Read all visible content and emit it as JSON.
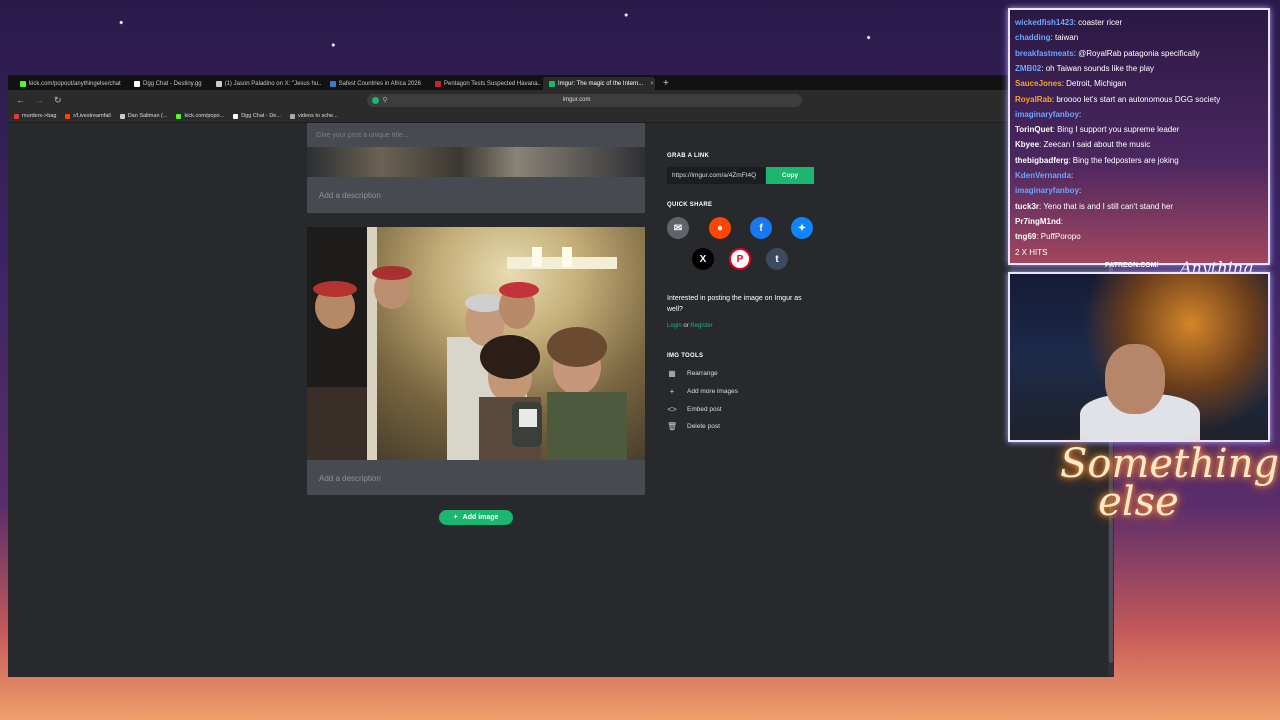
{
  "browser": {
    "tabs": [
      {
        "label": "kick.com/popout/anythingelse/chat",
        "color": "#53fc18",
        "active": false
      },
      {
        "label": "Dgg Chat - Destiny.gg",
        "color": "#ffffff",
        "active": false
      },
      {
        "label": "(1) Jason Paladino on X: \"Jesus hu...",
        "color": "#cccccc",
        "active": false
      },
      {
        "label": "Safest Countries in Africa 2026",
        "color": "#3d7bd8",
        "active": false
      },
      {
        "label": "Pentagon Tests Suspected Havana...",
        "color": "#c4262e",
        "active": false
      },
      {
        "label": "Imgur: The magic of the Intern...",
        "color": "#1bb76e",
        "active": true
      }
    ],
    "new_tab": "+",
    "address": "imgur.com",
    "bookmarks": [
      {
        "label": "murders->bag",
        "color": "#e33"
      },
      {
        "label": "r/Livestreamfail",
        "color": "#ff4500"
      },
      {
        "label": "Dan Saltman (...",
        "color": "#ccc"
      },
      {
        "label": "kick.com/popo...",
        "color": "#53fc18"
      },
      {
        "label": "Dgg Chat - De...",
        "color": "#fff"
      },
      {
        "label": "videos to sche...",
        "color": "#aaa"
      }
    ]
  },
  "post": {
    "title_placeholder": "Give your post a unique title...",
    "description_placeholder_1": "Add a description",
    "description_placeholder_2": "Add a description",
    "add_image": "Add image"
  },
  "sidebar": {
    "grab_link_heading": "GRAB A LINK",
    "link": "https://imgur.com/a/4ZmFt4Q",
    "copy": "Copy",
    "quick_share_heading": "QUICK SHARE",
    "interested_text": "Interested in posting the image on Imgur as well?",
    "login": "Login",
    "or": "or",
    "register": "Register",
    "img_tools_heading": "IMG TOOLS",
    "tools": [
      {
        "label": "Rearrange",
        "icon": "rearrange-icon"
      },
      {
        "label": "Add more images",
        "icon": "plus-icon"
      },
      {
        "label": "Embed post",
        "icon": "code-icon"
      },
      {
        "label": "Delete post",
        "icon": "trash-icon"
      }
    ]
  },
  "chat": [
    {
      "user": "wickedfish1423",
      "text": "coaster ricer",
      "color": "#6aa7ff"
    },
    {
      "user": "chadding",
      "text": "taiwan",
      "color": "#6aa7ff"
    },
    {
      "user": "breakfastmeats",
      "text": "@RoyalRab patagonia specifically",
      "color": "#6aa7ff"
    },
    {
      "user": "ZMB02",
      "text": "oh Taiwan sounds like the play",
      "color": "#6aa7ff"
    },
    {
      "user": "SauceJones",
      "text": "Detroit, Michigan",
      "color": "#f5a623"
    },
    {
      "user": "RoyalRab",
      "text": "broooo let's start an autonomous DGG society",
      "color": "#f5a623"
    },
    {
      "user": "imaginaryfanboy",
      "text": "",
      "color": "#6aa7ff"
    },
    {
      "user": "TorinQuet",
      "text": "Bing I support you supreme leader",
      "color": "#ffffff"
    },
    {
      "user": "Kbyee",
      "text": "Zeecan I said about the music",
      "color": "#ffffff"
    },
    {
      "user": "thebigbadferg",
      "text": "Bing the fedposters are joking",
      "color": "#ffffff"
    },
    {
      "user": "KdenVernanda",
      "text": "",
      "color": "#6aa7ff"
    },
    {
      "user": "imaginaryfanboy",
      "text": "",
      "color": "#6aa7ff"
    },
    {
      "user": "tuck3r",
      "text": "Yeno that is   and I still can't stand her",
      "color": "#ffffff"
    },
    {
      "user": "Pr7ingM1nd",
      "text": "",
      "color": "#ffffff"
    },
    {
      "user": "tng69",
      "text": "PuffPoropo",
      "color": "#ffffff"
    },
    {
      "user": "",
      "text": "2 X HITS",
      "color": "#ffffff"
    }
  ],
  "overlay": {
    "patreon": "PATREON.COM/",
    "signature": "Anything else",
    "neon": "Something else"
  }
}
